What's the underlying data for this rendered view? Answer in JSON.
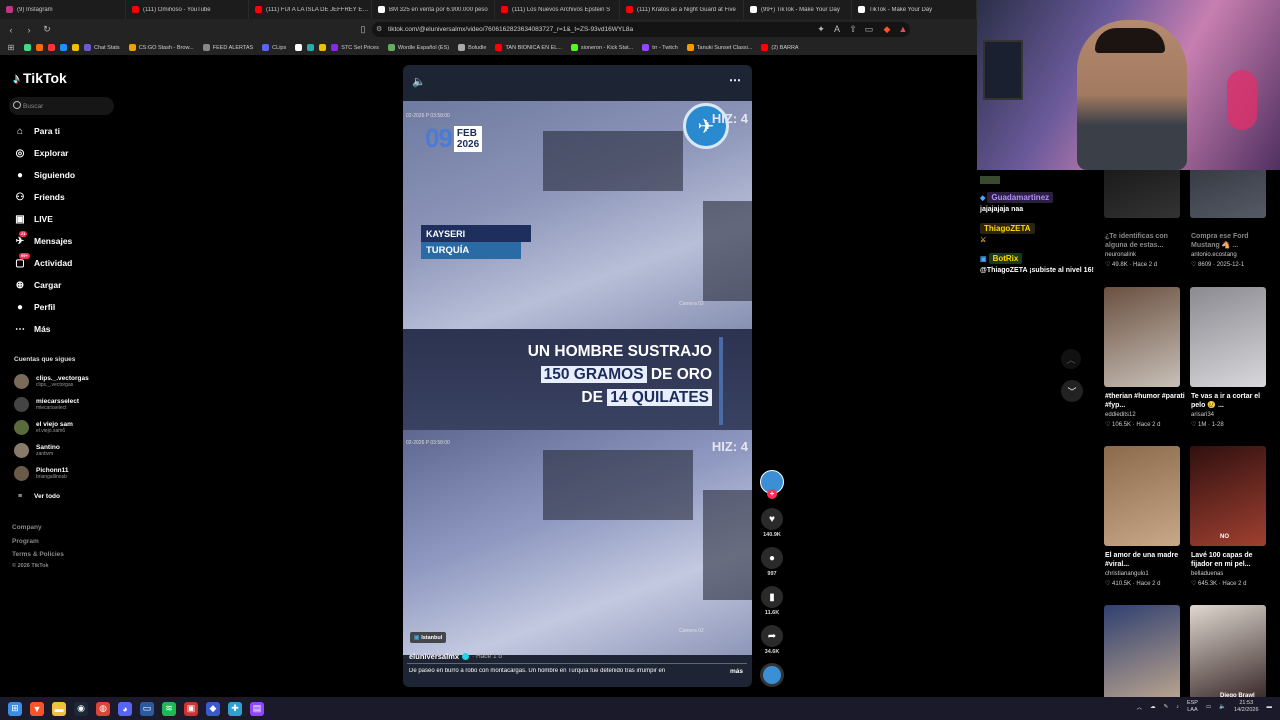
{
  "browser": {
    "tabs": [
      {
        "label": "(9) Instagram",
        "color": "#c13584",
        "w": 126
      },
      {
        "label": "(111) Ominoso - YouTube",
        "color": "#ff0000",
        "w": 123
      },
      {
        "label": "(111) FUI A LA ISLA DE JEFFREY EPST",
        "color": "#ff0000",
        "w": 123
      },
      {
        "label": "BM 325 en venta por 6.900.000 peso",
        "color": "#ffffff",
        "w": 123
      },
      {
        "label": "(111) Los Nuevos Archivos Epstein S",
        "color": "#ff0000",
        "w": 125
      },
      {
        "label": "(111) Kratos as a Night Guard at Five",
        "color": "#ff0000",
        "w": 124
      },
      {
        "label": "(99+) TikTok - Make Your Day",
        "color": "#ffffff",
        "w": 108
      },
      {
        "label": "TikTok - Make Your Day",
        "color": "#ffffff",
        "w": 125
      }
    ],
    "url": "tiktok.com/@eluniversalmx/video/7606162823634083727_r=1&_t=ZS-93vd16WYL8a",
    "bookmarks": [
      {
        "label": "",
        "color": "#3ddc84"
      },
      {
        "label": "",
        "color": "#ff6a00"
      },
      {
        "label": "",
        "color": "#ff3333"
      },
      {
        "label": "",
        "color": "#1e90ff"
      },
      {
        "label": "",
        "color": "#f0c000"
      },
      {
        "label": "Chat Stats",
        "color": "#6a5acd"
      },
      {
        "label": "CS:GO Stash - Brow...",
        "color": "#f0a000"
      },
      {
        "label": "FEED ALERTAS",
        "color": "#888888"
      },
      {
        "label": "CLips",
        "color": "#5865f2"
      },
      {
        "label": "",
        "color": "#ffffff"
      },
      {
        "label": "",
        "color": "#20b2aa"
      },
      {
        "label": "",
        "color": "#f0c000"
      },
      {
        "label": "STC Set Prices",
        "color": "#8a2be2"
      },
      {
        "label": "Wordle Español (ES)",
        "color": "#6aaa64"
      },
      {
        "label": "Boludle",
        "color": "#aaaaaa"
      },
      {
        "label": "TAN BIONICA EN EL...",
        "color": "#ff0000"
      },
      {
        "label": "sioneron - Kick Stat...",
        "color": "#53fc18"
      },
      {
        "label": "trr - Twitch",
        "color": "#9146ff"
      },
      {
        "label": "Tanuki Sunset Classi...",
        "color": "#ff9800"
      },
      {
        "label": "(2) BARRA",
        "color": "#ff0000"
      }
    ]
  },
  "tiktok": {
    "logo": "TikTok",
    "search_placeholder": "Buscar",
    "nav": [
      {
        "label": "Para ti",
        "icon": "home-icon",
        "glyph": "⌂",
        "badge": ""
      },
      {
        "label": "Explorar",
        "icon": "compass-icon",
        "glyph": "◎",
        "badge": ""
      },
      {
        "label": "Siguiendo",
        "icon": "avatar-icon",
        "glyph": "●",
        "badge": ""
      },
      {
        "label": "Friends",
        "icon": "friends-icon",
        "glyph": "⚇",
        "badge": ""
      },
      {
        "label": "LIVE",
        "icon": "live-icon",
        "glyph": "▣",
        "badge": ""
      },
      {
        "label": "Mensajes",
        "icon": "messages-icon",
        "glyph": "✈",
        "badge": "21"
      },
      {
        "label": "Actividad",
        "icon": "activity-icon",
        "glyph": "▢",
        "badge": "99+"
      },
      {
        "label": "Cargar",
        "icon": "upload-icon",
        "glyph": "⊕",
        "badge": ""
      },
      {
        "label": "Perfil",
        "icon": "profile-icon",
        "glyph": "●",
        "badge": ""
      },
      {
        "label": "Más",
        "icon": "more-icon",
        "glyph": "⋯",
        "badge": ""
      }
    ],
    "following_title": "Cuentas que sigues",
    "following": [
      {
        "name": "clips._.vectorgas",
        "handle": "clips._.vectorgas",
        "color": "#7a6a5a"
      },
      {
        "name": "miecarsselect",
        "handle": "miecarsselect",
        "color": "#444444"
      },
      {
        "name": "el viejo sam",
        "handle": "el.viejo.sam6",
        "color": "#5a6a3a"
      },
      {
        "name": "Santino",
        "handle": "zantivm",
        "color": "#8a7a6a"
      },
      {
        "name": "Pichonn11",
        "handle": "briangallinosb",
        "color": "#6a5a4a"
      }
    ],
    "see_all": "Ver todo",
    "footer": [
      "Company",
      "Program",
      "Terms & Policies",
      "© 2026 TikTok"
    ]
  },
  "video": {
    "date_day": "09",
    "date_month": "FEB",
    "date_year": "2026",
    "location_city": "KAYSERI",
    "location_country": "TURQUÍA",
    "watermark": "HIZ: 4",
    "cam_timestamp": "02-2026 P 03:58:00",
    "cam_name": "Camera 02",
    "caption_line1": "UN HOMBRE SUSTRAJO",
    "caption_line2_hl": "150 GRAMOS",
    "caption_line2_rest": " DE ORO",
    "caption_line3_pre": "DE ",
    "caption_line3_hl": "14 QUILATES",
    "place_tag": "Istanbul",
    "author": "eluniversalmx",
    "posted_ago": "· Hace 1 d",
    "description": "De paseo en burro a robo con montacargas. Un hombre en Turquía fue detenido tras irrumpir en",
    "more": "más",
    "likes": "140.9K",
    "comments": "997",
    "saves": "11.6K",
    "shares": "34.6K"
  },
  "stream": {
    "chat": [
      {
        "user": "Guadamartinez",
        "color": "#b58dff",
        "bg": "#2b2040",
        "message": "jajajajaja naa"
      },
      {
        "user": "ThiagoZETA",
        "color": "#ffd700",
        "bg": "#2a2410",
        "message": ""
      },
      {
        "user": "BotRix",
        "color": "#ffd700",
        "bg": "#1a3a1a",
        "message": "@ThiagoZETA ¡subiste al nivel 16!"
      }
    ],
    "suggested": [
      {
        "title": "¿Te identificas con alguna de estas...",
        "user": "neuronalink",
        "stats": "♡ 49.8K · Hace 2 d",
        "c1": "#111111",
        "c2": "#333333"
      },
      {
        "title": "Compra ese Ford Mustang 🐴 ...",
        "user": "antonio.ecostang",
        "stats": "♡ 8609 · 2025-12-1",
        "c1": "#2a2e36",
        "c2": "#555b66"
      },
      {
        "title": "#therian #humor #parati #fyp...",
        "user": "eddiedits12",
        "stats": "♡ 106.5K · Hace 2 d",
        "c1": "#6a5040",
        "c2": "#c8c0b8"
      },
      {
        "title": "Te vas a ir a cortar el pelo 😢 ...",
        "user": "arisari34",
        "stats": "♡ 1M · 1-28",
        "c1": "#8a8a90",
        "c2": "#d8d8dc"
      },
      {
        "title": "El amor de una madre #viral...",
        "user": "christianangulo1",
        "stats": "♡ 410.5K · Hace 2 d",
        "c1": "#8a6a4a",
        "c2": "#c8a888"
      },
      {
        "title": "Lavé 100 capas de fijador en mi pel...",
        "user": "belladuenas",
        "stats": "♡ 645.3K · Hace 2 d",
        "c1": "#301010",
        "c2": "#a04030"
      },
      {
        "title": "",
        "user": "",
        "stats": "",
        "c1": "#304070",
        "c2": "#c0a890"
      },
      {
        "title": "",
        "user": "",
        "stats": "",
        "c1": "#e0d8d0",
        "c2": "#302020"
      }
    ],
    "thumb_text": [
      "",
      "",
      "",
      "",
      "",
      "NO",
      "",
      "Diego Brawl"
    ]
  },
  "taskbar": {
    "lang": "ESP",
    "lang2": "LAA",
    "time": "21:53",
    "date": "14/2/2026",
    "apps": [
      {
        "name": "windows-start-icon",
        "color": "#3a8ee6",
        "glyph": "⊞"
      },
      {
        "name": "brave-browser-icon",
        "color": "#fb542b",
        "glyph": "▼"
      },
      {
        "name": "file-explorer-icon",
        "color": "#f0c040",
        "glyph": "▬"
      },
      {
        "name": "steam-icon",
        "color": "#1b2838",
        "glyph": "◉"
      },
      {
        "name": "chrome-icon",
        "color": "#db4437",
        "glyph": "◍"
      },
      {
        "name": "discord-icon",
        "color": "#5865f2",
        "glyph": "◕"
      },
      {
        "name": "chat-app-icon",
        "color": "#2c5aa0",
        "glyph": "▭"
      },
      {
        "name": "spotify-icon",
        "color": "#1db954",
        "glyph": "≋"
      },
      {
        "name": "obs-icon",
        "color": "#d03030",
        "glyph": "▣"
      },
      {
        "name": "network-app-icon",
        "color": "#3a5ad0",
        "glyph": "◆"
      },
      {
        "name": "puzzle-app-icon",
        "color": "#30a0d0",
        "glyph": "✚"
      },
      {
        "name": "twitch-icon",
        "color": "#9146ff",
        "glyph": "▤"
      }
    ]
  }
}
